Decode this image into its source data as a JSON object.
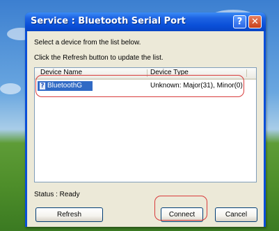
{
  "window": {
    "title": "Service : Bluetooth Serial Port",
    "help_glyph": "?",
    "close_glyph": "✕"
  },
  "instructions": {
    "line1": "Select a device from the list below.",
    "line2": "Click the Refresh button to update the list."
  },
  "list": {
    "columns": [
      "Device Name",
      "Device Type"
    ],
    "rows": [
      {
        "name": "BluetoothG",
        "type": "Unknown: Major(31), Minor(0)",
        "icon": "bluetooth-device-icon"
      }
    ]
  },
  "status": {
    "text": "Status : Ready"
  },
  "buttons": {
    "refresh": "Refresh",
    "connect": "Connect",
    "cancel": "Cancel"
  },
  "colors": {
    "titlebar": "#0a4fd8",
    "dialog_bg": "#ece9d8",
    "selection": "#316ac5",
    "annotation": "#d83a3a"
  }
}
